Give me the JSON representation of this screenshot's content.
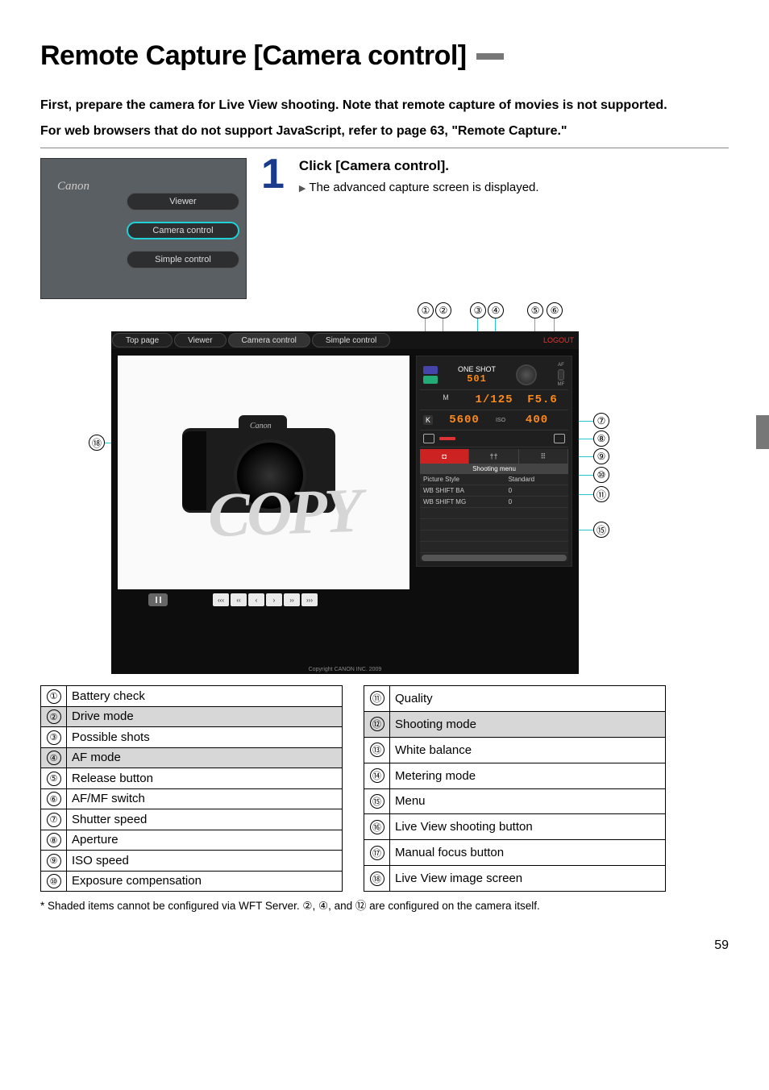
{
  "title": "Remote Capture [Camera control]",
  "intro1": "First, prepare the camera for Live View shooting. Note that remote capture of movies is not supported.",
  "intro2": "For web browsers that do not support JavaScript, refer to page 63, \"Remote Capture.\"",
  "step_number": "1",
  "step_heading": "Click [Camera control].",
  "step_bullet": "The advanced capture screen is displayed.",
  "thumb": {
    "brand": "Canon",
    "btn_viewer": "Viewer",
    "btn_camera_control": "Camera control",
    "btn_simple_control": "Simple control"
  },
  "main_shot": {
    "tabs": {
      "top": "Top page",
      "viewer": "Viewer",
      "camera": "Camera control",
      "simple": "Simple control"
    },
    "logout": "LOGOUT",
    "brand": "Canon",
    "watermark": "COPY",
    "panel": {
      "one_shot": "ONE SHOT",
      "shots": "501",
      "af": "AF",
      "mf": "MF",
      "mode": "M",
      "shutter": "1/125",
      "aperture": "F5.6",
      "wb_prefix": "K",
      "wb_k": "5600",
      "iso_label": "ISO",
      "iso": "400",
      "menu_tab_cam": "◘",
      "menu_tab_2": "††",
      "menu_tab_3": "⠿",
      "menu_title": "Shooting menu",
      "menu_items": [
        {
          "k": "Picture Style",
          "v": "Standard"
        },
        {
          "k": "WB SHIFT BA",
          "v": "0"
        },
        {
          "k": "WB SHIFT MG",
          "v": "0"
        }
      ]
    },
    "copyright": "Copyright CANON INC. 2009"
  },
  "callouts": [
    "①",
    "②",
    "③",
    "④",
    "⑤",
    "⑥",
    "⑦",
    "⑧",
    "⑨",
    "⑩",
    "⑪",
    "⑫",
    "⑬",
    "⑭",
    "⑮",
    "⑯",
    "⑰",
    "⑱"
  ],
  "focus_buttons": [
    "‹‹‹",
    "‹‹",
    "‹",
    "›",
    "››",
    "›››"
  ],
  "legend_left": [
    {
      "n": "①",
      "t": "Battery check",
      "shade": false
    },
    {
      "n": "②",
      "t": "Drive mode",
      "shade": true
    },
    {
      "n": "③",
      "t": "Possible shots",
      "shade": false
    },
    {
      "n": "④",
      "t": "AF mode",
      "shade": true
    },
    {
      "n": "⑤",
      "t": "Release button",
      "shade": false
    },
    {
      "n": "⑥",
      "t": "AF/MF switch",
      "shade": false
    },
    {
      "n": "⑦",
      "t": "Shutter speed",
      "shade": false
    },
    {
      "n": "⑧",
      "t": "Aperture",
      "shade": false
    },
    {
      "n": "⑨",
      "t": "ISO speed",
      "shade": false
    },
    {
      "n": "⑩",
      "t": "Exposure compensation",
      "shade": false
    }
  ],
  "legend_right": [
    {
      "n": "⑪",
      "t": "Quality",
      "shade": false
    },
    {
      "n": "⑫",
      "t": "Shooting mode",
      "shade": true
    },
    {
      "n": "⑬",
      "t": "White balance",
      "shade": false
    },
    {
      "n": "⑭",
      "t": "Metering mode",
      "shade": false
    },
    {
      "n": "⑮",
      "t": "Menu",
      "shade": false
    },
    {
      "n": "⑯",
      "t": "Live View shooting button",
      "shade": false
    },
    {
      "n": "⑰",
      "t": "Manual focus button",
      "shade": false
    },
    {
      "n": "⑱",
      "t": "Live View image screen",
      "shade": false
    }
  ],
  "footnote": "* Shaded items cannot be configured via WFT Server. ②, ④, and ⑫ are configured on the camera itself.",
  "page_number": "59"
}
